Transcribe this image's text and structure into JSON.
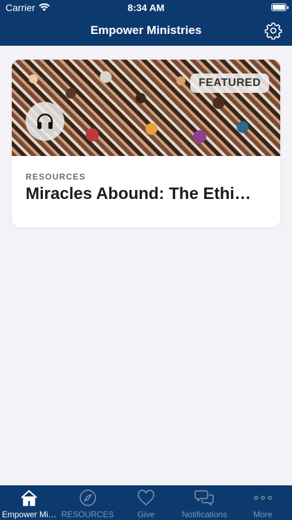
{
  "status_bar": {
    "carrier": "Carrier",
    "time": "8:34 AM",
    "wifi_icon": "wifi-icon",
    "battery_icon": "battery-icon"
  },
  "nav": {
    "title": "Empower Ministries",
    "settings_icon": "gear-icon"
  },
  "feed": {
    "cards": [
      {
        "badge": "FEATURED",
        "category": "RESOURCES",
        "title": "Miracles Abound: The Ethi…",
        "media_icon": "headphones-icon"
      }
    ]
  },
  "tab_bar": {
    "items": [
      {
        "label": "Empower Mi…",
        "icon": "home-icon",
        "active": true
      },
      {
        "label": "RESOURCES",
        "icon": "compass-icon",
        "active": false
      },
      {
        "label": "Give",
        "icon": "heart-icon",
        "active": false
      },
      {
        "label": "Notifications",
        "icon": "chat-icon",
        "active": false
      },
      {
        "label": "More",
        "icon": "more-icon",
        "active": false
      }
    ]
  },
  "colors": {
    "brand": "#0d3a6e",
    "background": "#f2f2f7",
    "tab_active": "#ffffff",
    "tab_inactive": "#7f95b3"
  }
}
